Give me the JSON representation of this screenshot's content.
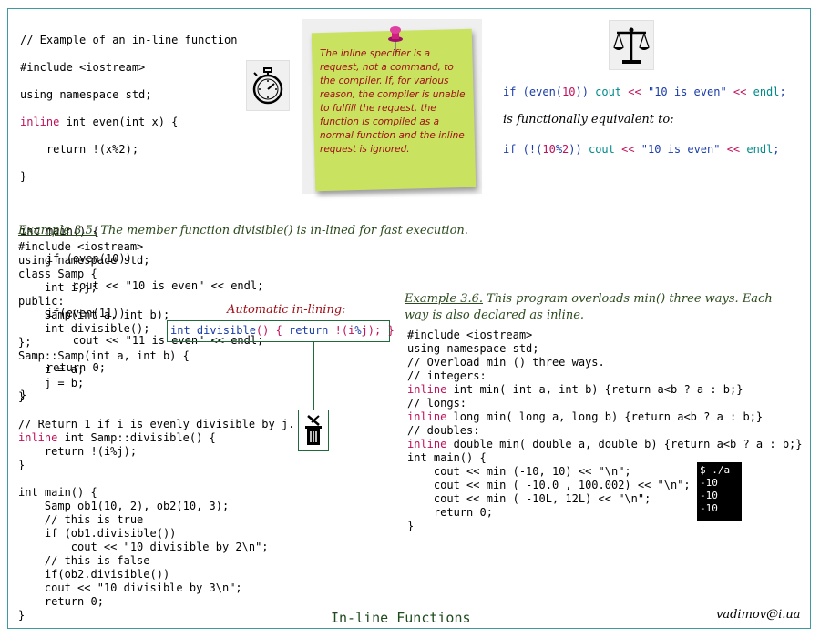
{
  "code1": {
    "l1": "// Example of an in-line function",
    "l2": "#include <iostream>",
    "l3": "using namespace std;",
    "l4_kw": "inline",
    "l4_rest": " int even(int x) {",
    "l5": "    return !(x%2);",
    "l6": "}",
    "l7": "",
    "l8": "int main() {",
    "l9": "    if (even(10))",
    "l10": "        cout << \"10 is even\" << endl;",
    "l11": "    if(even(11))",
    "l12": "        cout << \"11 is even\" << endl;",
    "l13": "    return 0;",
    "l14": "}"
  },
  "sticky_note": "The inline specifier is a request, not a command, to the compiler. If, for various reason, the compiler is unable to fulfill the request, the function is compiled as a normal function and the inline request is ignored.",
  "equivalence": {
    "line1": {
      "p1": "if (even(",
      "num": "10",
      "p2": ")) ",
      "cout": "cout",
      "p3": " << ",
      "str": "\"10 is even\"",
      "p4": " << ",
      "endl": "endl",
      "p5": ";"
    },
    "middle": "is functionally equivalent to:",
    "line2": {
      "p1": "if (!(",
      "num1": "10",
      "op": "%",
      "num2": "2",
      "p2": ")) ",
      "cout": "cout",
      "p3": " << ",
      "str": "\"10 is even\"",
      "p4": " << ",
      "endl": "endl",
      "p5": ";"
    }
  },
  "example35": {
    "label": "Example 3.5.",
    "text": " The member function divisible() is in-lined for fast execution.",
    "code_a": "#include <iostream>\nusing namespace std;\nclass Samp {\n    int i,j;\npublic:\n    Samp(int a, int b);\n    int divisible();\n};\nSamp::Samp(int a, int b) {\n    i = a;\n    j = b;\n}",
    "code_b1": "// Return 1 if i is evenly divisible by j.",
    "code_b2_kw": "inline",
    "code_b2_rest": " int Samp::divisible() {",
    "code_b3": "    return !(i%j);\n}",
    "code_c": "int main() {\n    Samp ob1(10, 2), ob2(10, 3);\n    // this is true\n    if (ob1.divisible())\n        cout << \"10 divisible by 2\\n\";\n    // this is false\n    if(ob2.divisible())\n    cout << \"10 divisible by 3\\n\";\n    return 0;\n}"
  },
  "auto_inline": {
    "label": "Automatic in-lining:",
    "a": "int divisible",
    "b": "() { ",
    "c": "return",
    "d": " !(i",
    "e": "%",
    "f": "j); }"
  },
  "example36": {
    "label": "Example 3.6.",
    "text": " This program overloads min() three ways. Each way is also declared as inline.",
    "c1": "#include <iostream>\nusing namespace std;\n// Overload min () three ways.\n// integers:",
    "c2_kw": "inline",
    "c2_rest": " int min( int a, int b) {return a<b ? a : b;}",
    "c3": "// longs:",
    "c4_kw": "inline",
    "c4_rest": " long min( long a, long b) {return a<b ? a : b;}",
    "c5": "// doubles:",
    "c6_kw": "inline",
    "c6_rest": " double min( double a, double b) {return a<b ? a : b;}",
    "c7": "int main() {\n    cout << min (-10, 10) << \"\\n\";\n    cout << min ( -10.0 , 100.002) << \"\\n\";\n    cout << min ( -10L, 12L) << \"\\n\";\n    return 0;\n}"
  },
  "terminal": "$ ./a\n-10\n-10\n-10",
  "footer": {
    "title": "In-line Functions",
    "email": "vadimov@i.ua"
  },
  "icons": [
    "stopwatch-icon",
    "balance-scale-icon",
    "trash-icon",
    "pushpin-icon"
  ]
}
